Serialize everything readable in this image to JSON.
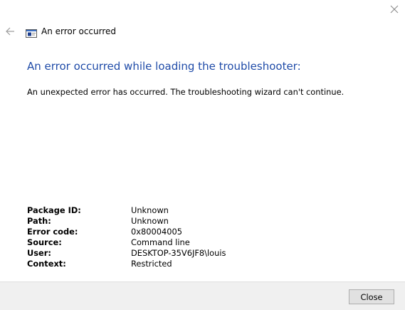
{
  "window": {
    "close_icon": "close-x-icon"
  },
  "header": {
    "back_icon": "back-arrow-icon",
    "app_icon": "troubleshooter-window-icon",
    "title": "An error occurred"
  },
  "main": {
    "heading": "An error occurred while loading the troubleshooter:",
    "message": "An unexpected error has occurred. The troubleshooting wizard can't continue."
  },
  "details": [
    {
      "label": "Package ID:",
      "value": "Unknown"
    },
    {
      "label": "Path:",
      "value": "Unknown"
    },
    {
      "label": "Error code:",
      "value": "0x80004005"
    },
    {
      "label": "Source:",
      "value": "Command line"
    },
    {
      "label": "User:",
      "value": "DESKTOP-35V6JF8\\louis"
    },
    {
      "label": "Context:",
      "value": "Restricted"
    }
  ],
  "footer": {
    "close_label": "Close"
  },
  "colors": {
    "heading": "#1f4ba8",
    "footer_bg": "#f0f0f0",
    "button_bg": "#e1e1e1",
    "button_border": "#adadad"
  }
}
